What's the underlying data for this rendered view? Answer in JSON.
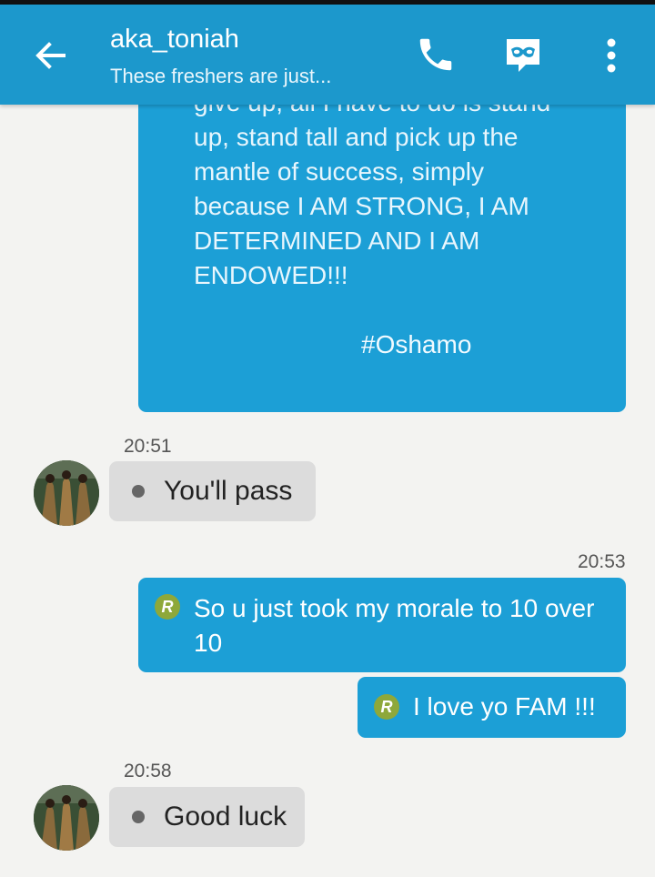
{
  "header": {
    "contact_name": "aka_toniah",
    "status": "These freshers are just...",
    "icons": {
      "back": "back-arrow-icon",
      "call": "phone-icon",
      "mask": "incognito-mask-icon",
      "more": "more-vert-icon"
    }
  },
  "messages": {
    "partial_out": {
      "text": "give up, all I have to do is stand\nup, stand tall and pick up the\nmantle of success, simply\nbecause I AM STRONG, I AM\nDETERMINED AND I AM\nENDOWED!!!",
      "hashtag": "#Oshamo"
    },
    "in1": {
      "time": "20:51",
      "text": "You'll pass"
    },
    "out1": {
      "time": "20:53",
      "badge": "R",
      "text": "So u just took  my morale to 10 over 10"
    },
    "out2": {
      "badge": "R",
      "text": "I love yo FAM !!!"
    },
    "in2": {
      "time": "20:58",
      "text": "Good luck"
    }
  },
  "colors": {
    "appbar": "#1c98cc",
    "bubble_out": "#1c9fd6",
    "bubble_in": "#dcdcdc",
    "background": "#f3f3f1",
    "badge": "#8ea83a"
  }
}
